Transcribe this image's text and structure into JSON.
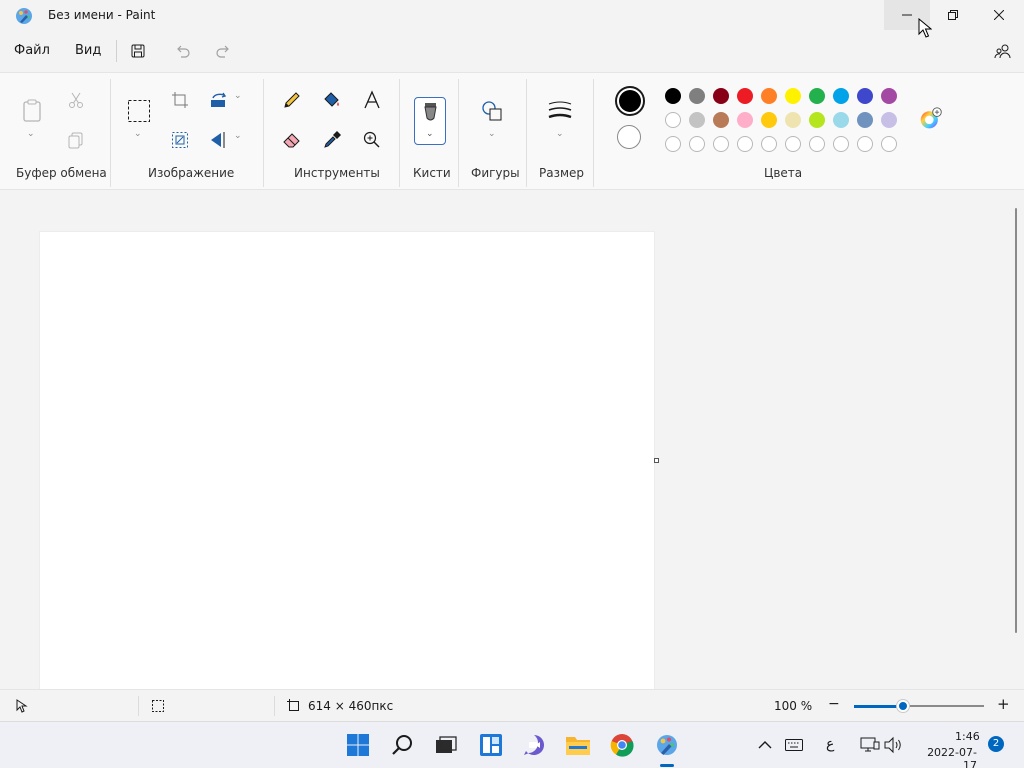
{
  "window": {
    "title": "Без имени - Paint"
  },
  "menu": {
    "file": "Файл",
    "view": "Вид"
  },
  "ribbon": {
    "groups": {
      "clipboard": "Буфер обмена",
      "image": "Изображение",
      "tools": "Инструменты",
      "brushes": "Кисти",
      "shapes": "Фигуры",
      "size": "Размер",
      "colors": "Цвета"
    },
    "primary_color": "#000000",
    "secondary_color": "#ffffff",
    "palette_row1": [
      "#000000",
      "#7f7f7f",
      "#880015",
      "#ed1c24",
      "#ff7f27",
      "#fff200",
      "#22b14c",
      "#00a2e8",
      "#3f48cc",
      "#a349a4"
    ],
    "palette_row2": [
      "#ffffff",
      "#c3c3c3",
      "#b97a57",
      "#ffaec9",
      "#ffc90e",
      "#efe4b0",
      "#b5e61d",
      "#99d9ea",
      "#7092be",
      "#c8bfe7"
    ]
  },
  "status": {
    "canvas_size": "614 × 460пкс",
    "zoom": "100 %",
    "zoom_fraction": 0.38
  },
  "taskbar": {
    "time": "1:46",
    "date": "2022-07-17",
    "notifications": "2",
    "lang": "ع"
  }
}
